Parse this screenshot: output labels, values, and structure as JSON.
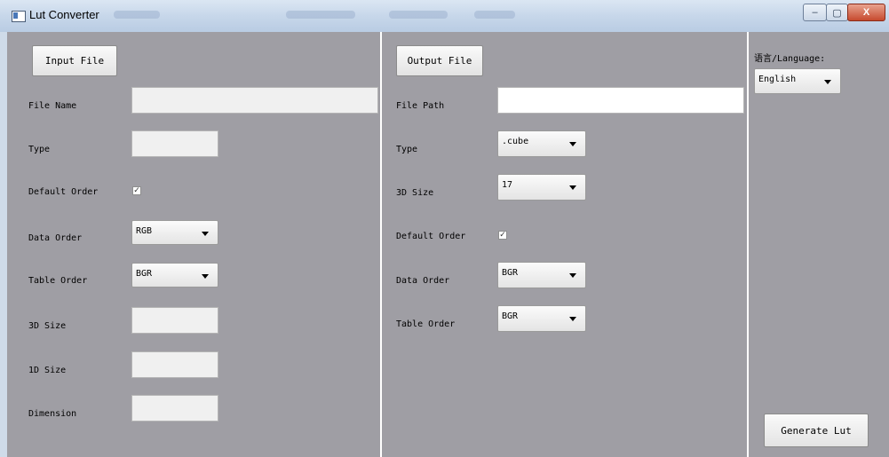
{
  "window": {
    "title": "Lut Converter",
    "controls": {
      "minimize": "–",
      "maximize": "▢",
      "close": "X"
    }
  },
  "input": {
    "button_label": "Input File",
    "file_name_label": "File Name",
    "file_name_value": "",
    "type_label": "Type",
    "type_value": "",
    "default_order_label": "Default Order",
    "default_order_checked": true,
    "data_order_label": "Data Order",
    "data_order_value": "RGB",
    "table_order_label": "Table Order",
    "table_order_value": "BGR",
    "size3d_label": "3D Size",
    "size3d_value": "",
    "size1d_label": "1D Size",
    "size1d_value": "",
    "dimension_label": "Dimension",
    "dimension_value": ""
  },
  "output": {
    "button_label": "Output File",
    "file_path_label": "File Path",
    "file_path_value": "",
    "type_label": "Type",
    "type_value": ".cube",
    "size3d_label": "3D Size",
    "size3d_value": "17",
    "default_order_label": "Default Order",
    "default_order_checked": true,
    "data_order_label": "Data Order",
    "data_order_value": "BGR",
    "table_order_label": "Table Order",
    "table_order_value": "BGR"
  },
  "settings": {
    "language_label": "语言/Language:",
    "language_value": "English",
    "generate_label": "Generate Lut"
  },
  "check_glyph": "✓"
}
